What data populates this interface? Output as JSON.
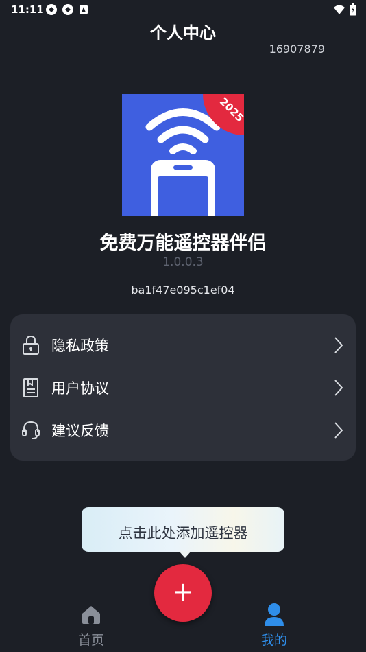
{
  "status_bar": {
    "time": "11:11"
  },
  "header": {
    "title": "个人中心",
    "user_id": "16907879"
  },
  "app": {
    "badge_text": "2025",
    "name": "免费万能遥控器伴侣",
    "version": "1.0.0.3",
    "device_id": "ba1f47e095c1ef04"
  },
  "menu": {
    "items": [
      {
        "label": "隐私政策",
        "icon": "lock-icon"
      },
      {
        "label": "用户协议",
        "icon": "document-icon"
      },
      {
        "label": "建议反馈",
        "icon": "headset-icon"
      }
    ]
  },
  "tooltip": {
    "text": "点击此处添加遥控器"
  },
  "fab": {
    "label": "+"
  },
  "bottom_nav": {
    "items": [
      {
        "label": "首页",
        "icon": "home-icon",
        "active": false
      },
      {
        "label": "我的",
        "icon": "user-icon",
        "active": true
      }
    ]
  },
  "colors": {
    "background": "#1c1f26",
    "card": "#2d3039",
    "accent_red": "#e3293f",
    "active_blue": "#2f8eea",
    "logo_blue": "#3f5fe0"
  }
}
